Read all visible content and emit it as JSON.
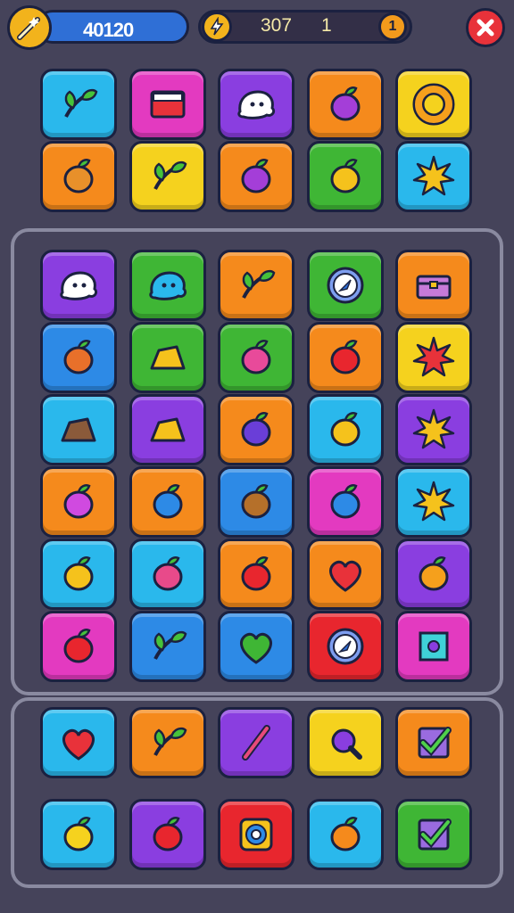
{
  "hud": {
    "score": "40120",
    "mid_value_a": "307",
    "mid_value_b": "1",
    "coin_symbol": "1"
  },
  "colors": {
    "cyan": "#2ab8ec",
    "magenta": "#e33ac0",
    "purple": "#8a3ee0",
    "orange": "#f58a1c",
    "yellow": "#f5d21e",
    "green": "#3fb635",
    "blue": "#2d8ae6",
    "red": "#e8262e"
  },
  "top_grid": [
    {
      "bg": "cyan",
      "icon": "leaf-branch-icon"
    },
    {
      "bg": "magenta",
      "icon": "box-icon"
    },
    {
      "bg": "purple",
      "icon": "ghost-icon"
    },
    {
      "bg": "orange",
      "icon": "bag-icon"
    },
    {
      "bg": "yellow",
      "icon": "ring-icon"
    },
    {
      "bg": "orange",
      "icon": "pineapple-icon"
    },
    {
      "bg": "yellow",
      "icon": "leaf-bowl-icon"
    },
    {
      "bg": "orange",
      "icon": "eggplant-icon"
    },
    {
      "bg": "green",
      "icon": "lemon-icon"
    },
    {
      "bg": "cyan",
      "icon": "sun-icon"
    }
  ],
  "main_grid": [
    {
      "bg": "purple",
      "icon": "ghost-icon"
    },
    {
      "bg": "green",
      "icon": "blob-icon"
    },
    {
      "bg": "orange",
      "icon": "feather-icon"
    },
    {
      "bg": "green",
      "icon": "compass-icon"
    },
    {
      "bg": "orange",
      "icon": "chest-icon"
    },
    {
      "bg": "blue",
      "icon": "rolling-pin-icon"
    },
    {
      "bg": "green",
      "icon": "cheese-icon"
    },
    {
      "bg": "green",
      "icon": "flower-icon"
    },
    {
      "bg": "orange",
      "icon": "orb-icon"
    },
    {
      "bg": "yellow",
      "icon": "sun-face-icon"
    },
    {
      "bg": "cyan",
      "icon": "rock-icon"
    },
    {
      "bg": "purple",
      "icon": "cheese-block-icon"
    },
    {
      "bg": "orange",
      "icon": "plum-icon"
    },
    {
      "bg": "cyan",
      "icon": "spiky-ball-icon"
    },
    {
      "bg": "purple",
      "icon": "star-icon"
    },
    {
      "bg": "orange",
      "icon": "butterfly-icon"
    },
    {
      "bg": "orange",
      "icon": "berry-branch-icon"
    },
    {
      "bg": "blue",
      "icon": "nut-icon"
    },
    {
      "bg": "magenta",
      "icon": "pin-icon"
    },
    {
      "bg": "cyan",
      "icon": "sun-icon"
    },
    {
      "bg": "cyan",
      "icon": "lemon-icon"
    },
    {
      "bg": "cyan",
      "icon": "strawberry-icon"
    },
    {
      "bg": "orange",
      "icon": "chili-icon"
    },
    {
      "bg": "orange",
      "icon": "heart-icon"
    },
    {
      "bg": "purple",
      "icon": "swirl-icon"
    },
    {
      "bg": "magenta",
      "icon": "apple-icon"
    },
    {
      "bg": "blue",
      "icon": "sprout-icon"
    },
    {
      "bg": "blue",
      "icon": "green-heart-icon"
    },
    {
      "bg": "red",
      "icon": "compass-icon"
    },
    {
      "bg": "magenta",
      "icon": "gem-icon"
    }
  ],
  "bottom_grid": [
    {
      "bg": "cyan",
      "icon": "heart-icon"
    },
    {
      "bg": "orange",
      "icon": "sprout-icon"
    },
    {
      "bg": "purple",
      "icon": "brush-icon"
    },
    {
      "bg": "yellow",
      "icon": "magnifier-icon"
    },
    {
      "bg": "orange",
      "icon": "check-box-icon"
    },
    {
      "bg": "cyan",
      "icon": "horn-icon"
    },
    {
      "bg": "purple",
      "icon": "rose-icon"
    },
    {
      "bg": "red",
      "icon": "gear-icon"
    },
    {
      "bg": "cyan",
      "icon": "peach-icon"
    },
    {
      "bg": "green",
      "icon": "check-box-icon"
    }
  ]
}
